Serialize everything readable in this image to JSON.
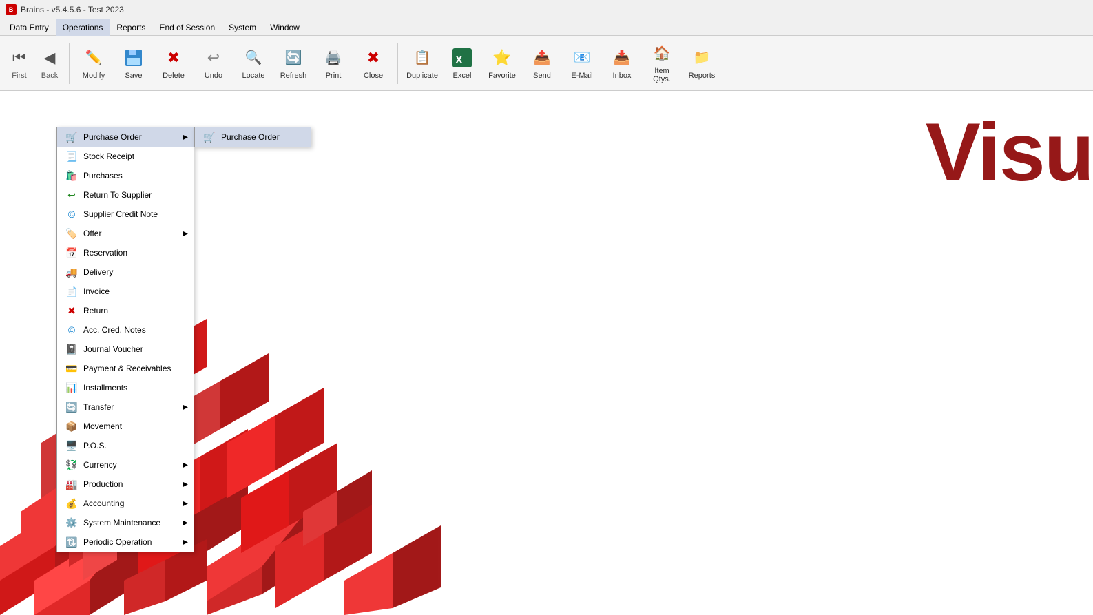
{
  "titleBar": {
    "title": "Brains - v5.4.5.6 - Test 2023"
  },
  "menuBar": {
    "items": [
      {
        "id": "data-entry",
        "label": "Data Entry"
      },
      {
        "id": "operations",
        "label": "Operations",
        "active": true
      },
      {
        "id": "reports",
        "label": "Reports"
      },
      {
        "id": "end-of-session",
        "label": "End of Session"
      },
      {
        "id": "system",
        "label": "System"
      },
      {
        "id": "window",
        "label": "Window"
      }
    ]
  },
  "toolbar": {
    "buttons": [
      {
        "id": "first",
        "label": "First",
        "icon": "⏮"
      },
      {
        "id": "back",
        "label": "Back",
        "icon": "◀"
      },
      {
        "id": "modify",
        "label": "Modify",
        "icon": "✏"
      },
      {
        "id": "save",
        "label": "Save",
        "icon": "💾"
      },
      {
        "id": "delete",
        "label": "Delete",
        "icon": "🗑"
      },
      {
        "id": "undo",
        "label": "Undo",
        "icon": "↩"
      },
      {
        "id": "locate",
        "label": "Locate",
        "icon": "🔍"
      },
      {
        "id": "refresh",
        "label": "Refresh",
        "icon": "🔄"
      },
      {
        "id": "print",
        "label": "Print",
        "icon": "🖨"
      },
      {
        "id": "close",
        "label": "Close",
        "icon": "✖"
      },
      {
        "id": "duplicate",
        "label": "Duplicate",
        "icon": "📋"
      },
      {
        "id": "excel",
        "label": "Excel",
        "icon": "📊"
      },
      {
        "id": "favorite",
        "label": "Favorite",
        "icon": "⭐"
      },
      {
        "id": "send",
        "label": "Send",
        "icon": "📤"
      },
      {
        "id": "email",
        "label": "E-Mail",
        "icon": "📧"
      },
      {
        "id": "inbox",
        "label": "Inbox",
        "icon": "📥"
      },
      {
        "id": "item-qtys",
        "label": "Item Qtys.",
        "icon": "🏠"
      },
      {
        "id": "reports",
        "label": "Reports",
        "icon": "📁"
      }
    ]
  },
  "operationsMenu": {
    "items": [
      {
        "id": "purchase-order",
        "label": "Purchase Order",
        "icon": "cart",
        "hasSubmenu": true,
        "highlighted": true
      },
      {
        "id": "stock-receipt",
        "label": "Stock Receipt",
        "icon": "receipt"
      },
      {
        "id": "purchases",
        "label": "Purchases",
        "icon": "bag"
      },
      {
        "id": "return-to-supplier",
        "label": "Return To Supplier",
        "icon": "return"
      },
      {
        "id": "supplier-credit-note",
        "label": "Supplier Credit Note",
        "icon": "credit"
      },
      {
        "id": "offer",
        "label": "Offer",
        "icon": "offer",
        "hasSubmenu": true
      },
      {
        "id": "reservation",
        "label": "Reservation",
        "icon": "reservation"
      },
      {
        "id": "delivery",
        "label": "Delivery",
        "icon": "delivery"
      },
      {
        "id": "invoice",
        "label": "Invoice",
        "icon": "invoice"
      },
      {
        "id": "return",
        "label": "Return",
        "icon": "return2"
      },
      {
        "id": "acc-cred-notes",
        "label": "Acc. Cred. Notes",
        "icon": "accnotes"
      },
      {
        "id": "journal-voucher",
        "label": "Journal Voucher",
        "icon": "journal"
      },
      {
        "id": "payment-receivables",
        "label": "Payment & Receivables",
        "icon": "payment"
      },
      {
        "id": "installments",
        "label": "Installments",
        "icon": "installments"
      },
      {
        "id": "transfer",
        "label": "Transfer",
        "icon": "transfer",
        "hasSubmenu": true
      },
      {
        "id": "movement",
        "label": "Movement",
        "icon": "movement"
      },
      {
        "id": "pos",
        "label": "P.O.S.",
        "icon": "pos"
      },
      {
        "id": "currency",
        "label": "Currency",
        "icon": "currency",
        "hasSubmenu": true
      },
      {
        "id": "production",
        "label": "Production",
        "icon": "production",
        "hasSubmenu": true
      },
      {
        "id": "accounting",
        "label": "Accounting",
        "icon": "accounting",
        "hasSubmenu": true
      },
      {
        "id": "system-maintenance",
        "label": "System Maintenance",
        "icon": "sysmaint",
        "hasSubmenu": true
      },
      {
        "id": "periodic-operation",
        "label": "Periodic Operation",
        "icon": "periodic",
        "hasSubmenu": true
      }
    ]
  },
  "purchaseOrderSubmenu": {
    "items": [
      {
        "id": "purchase-order-sub",
        "label": "Purchase Order",
        "icon": "cart"
      }
    ]
  },
  "visuText": "Visu",
  "icons": {
    "cart": "🛒",
    "receipt": "📃",
    "bag": "🛍",
    "return_arrow": "↩",
    "credit": "©",
    "offer": "🏷",
    "reservation": "📅",
    "delivery": "🚚",
    "invoice": "📄",
    "return2": "✖",
    "accnotes": "©",
    "journal": "📓",
    "payment": "💳",
    "installments": "📊",
    "transfer": "🔄",
    "movement": "📦",
    "pos": "🖥",
    "currency": "💱",
    "production": "🏭",
    "accounting": "💰",
    "sysmaint": "⚙",
    "periodic": "🔃"
  }
}
